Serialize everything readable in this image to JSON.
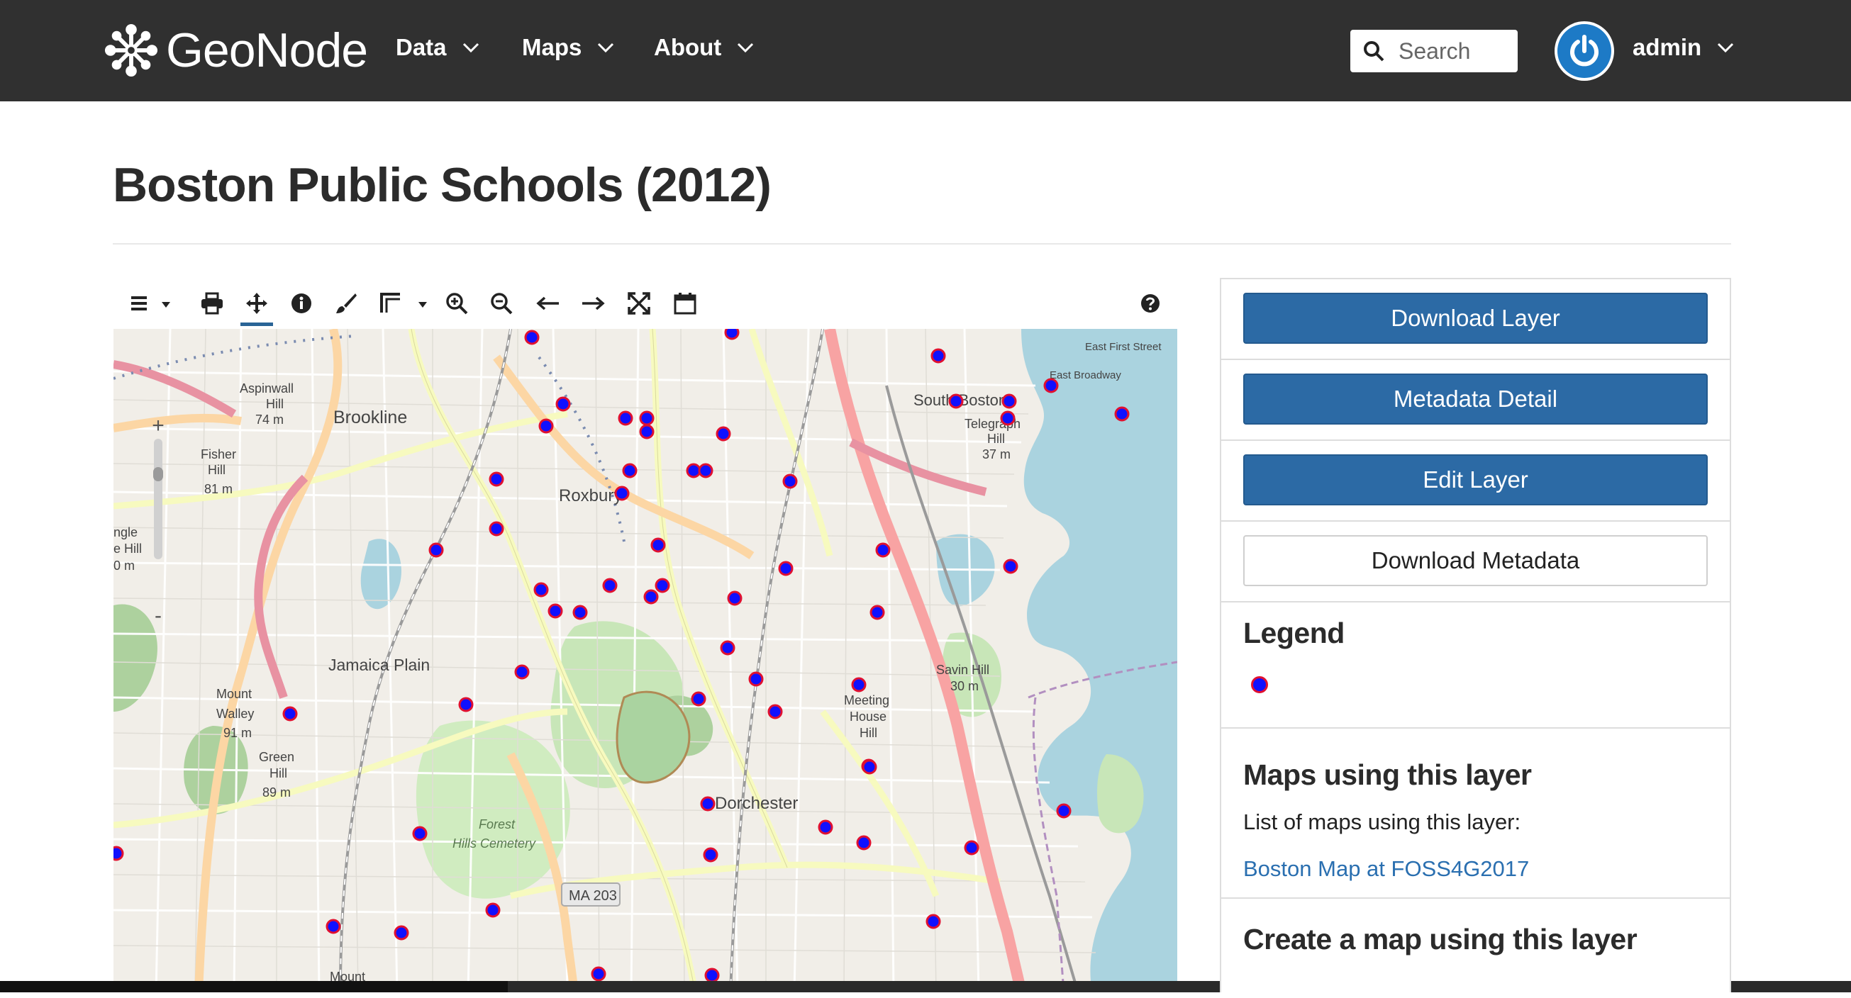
{
  "brand": {
    "name": "GeoNode"
  },
  "nav": {
    "items": [
      {
        "label": "Data"
      },
      {
        "label": "Maps"
      },
      {
        "label": "About"
      }
    ],
    "search_placeholder": "Search",
    "user": "admin"
  },
  "page": {
    "title": "Boston Public Schools (2012)"
  },
  "map": {
    "labels": {
      "brookline": "Brookline",
      "aspinwall": "Aspinwall",
      "hill1": "Hill",
      "m74": "74 m",
      "fisher": "Fisher",
      "hill2": "Hill",
      "m81": "81 m",
      "roxbury": "Roxbury",
      "southboston": "South Boston",
      "telegraph": "Telegraph",
      "hill3": "Hill",
      "m37": "37 m",
      "jamaicaplain": "Jamaica Plain",
      "mountwalley": "Mount",
      "walley": "Walley",
      "m91": "91 m",
      "green": "Green",
      "hill4": "Hill",
      "m89": "89 m",
      "forest": "Forest",
      "hillscemetery": "Hills Cemetery",
      "dorchester": "Dorchester",
      "savinhill": "Savin Hill",
      "m30": "30 m",
      "meeting": "Meeting",
      "house": "House",
      "hill5": "Hill",
      "ma203": "MA 203",
      "eastfirst": "East First Street",
      "eastbroadway": "East Broadway",
      "mount2": "Mount",
      "ngle": "ngle",
      "ehill": "e Hill",
      "om": "0 m"
    }
  },
  "panel": {
    "download_layer": "Download Layer",
    "metadata_detail": "Metadata Detail",
    "edit_layer": "Edit Layer",
    "download_metadata": "Download Metadata",
    "legend_title": "Legend",
    "maps_title": "Maps using this layer",
    "maps_text": "List of maps using this layer:",
    "maps_link": "Boston Map at FOSS4G2017",
    "create_title": "Create a map using this layer"
  },
  "colors": {
    "navbar": "#303030",
    "primary_button": "#2c6aa5",
    "link": "#2a6fb0",
    "legend_point_fill": "#1010ff",
    "legend_point_stroke": "#e01030"
  },
  "icons": {
    "toolbar": [
      "layers-icon",
      "print-icon",
      "pan-icon",
      "info-icon",
      "style-brush-icon",
      "measure-icon",
      "zoom-in-icon",
      "zoom-out-icon",
      "previous-extent-icon",
      "next-extent-icon",
      "full-extent-icon",
      "calendar-icon",
      "help-icon"
    ]
  }
}
